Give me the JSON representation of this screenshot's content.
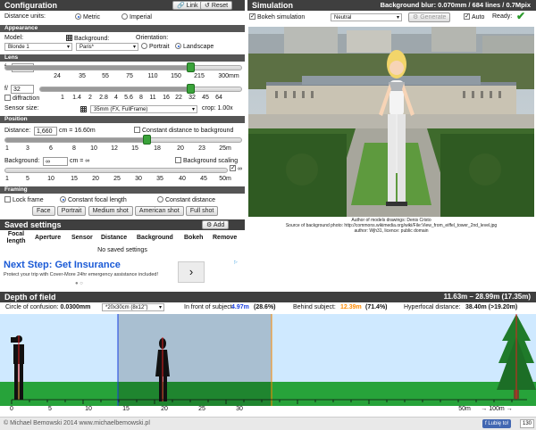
{
  "config": {
    "title": "Configuration",
    "link_label": "Link",
    "reset_label": "Reset",
    "distance_units_label": "Distance units:",
    "metric_label": "Metric",
    "imperial_label": "Imperial",
    "appearance_label": "Appearance",
    "model_label": "Model:",
    "model_value": "Blonde 1",
    "background_label": "Background:",
    "background_value": "Paris*",
    "orientation_label": "Orientation:",
    "portrait_label": "Portrait",
    "landscape_label": "Landscape",
    "lens_label": "Lens",
    "f_label": "f=",
    "f_value": "192",
    "f_unit": "mm",
    "focal_ticks": [
      "24",
      "35",
      "55",
      "75",
      "110",
      "150",
      "215",
      "300mm"
    ],
    "aperture_label": "f/",
    "aperture_value": "32",
    "diffraction_label": "diffraction",
    "aperture_ticks": [
      "1",
      "1.4",
      "2",
      "2.8",
      "4",
      "5.6",
      "8",
      "11",
      "16",
      "22",
      "32",
      "45",
      "64"
    ],
    "sensor_label": "Sensor size:",
    "sensor_value": "35mm (FX, FullFrame)",
    "crop_label": "crop: 1.00x",
    "position_label": "Position",
    "distance_label": "Distance:",
    "distance_value": "1,660",
    "distance_unit": "cm = 16.60m",
    "constant_distance_bg_label": "Constant distance to background",
    "distance_ticks": [
      "1",
      "3",
      "6",
      "8",
      "10",
      "12",
      "15",
      "18",
      "20",
      "23",
      "25m"
    ],
    "background_dist_label": "Background:",
    "background_dist_value": "∞",
    "background_dist_unit": "cm = ∞",
    "background_scaling_label": "Background scaling",
    "infinity_label": "∞",
    "background_ticks": [
      "1",
      "5",
      "10",
      "15",
      "20",
      "25",
      "30",
      "35",
      "40",
      "45",
      "50m"
    ],
    "framing_label": "Framing",
    "lock_frame_label": "Lock frame",
    "constant_focal_label": "Constant focal length",
    "constant_distance_label": "Constant distance",
    "framing_buttons": [
      "Face",
      "Portrait",
      "Medium shot",
      "American shot",
      "Full shot"
    ]
  },
  "saved": {
    "title": "Saved settings",
    "add_label": "Add",
    "columns": [
      "Focal length",
      "Aperture",
      "Sensor",
      "Distance",
      "Background",
      "Bokeh",
      "Remove"
    ],
    "empty_label": "No saved settings"
  },
  "ad": {
    "title": "Next Step: Get Insurance",
    "body": "Protect your trip with Cover-More 24hr emergency assistance included!"
  },
  "simulation": {
    "title": "Simulation",
    "info": "Background blur: 0.070mm / 684 lines / 0.7Mpix",
    "bokeh_label": "Bokeh simulation",
    "bokeh_mode": "Neutral",
    "generate_label": "Generate",
    "auto_label": "Auto",
    "ready_label": "Ready:",
    "credit_line1": "Author of models drawings: Denis Cristo",
    "credit_line2": "Source of background photo: http://commons.wikimedia.org/wiki/File:View_from_eiffel_tower_2nd_level.jpg",
    "credit_line3": "author: Wjh31, licence: public domain"
  },
  "dof": {
    "title": "Depth of field",
    "range": "11.63m – 28.99m (17.35m)",
    "coc_label": "Circle of confusion:",
    "coc_value": "0.0300mm",
    "coc_select": "*20x30cm (8x12\")",
    "front_label": "In front of subject:",
    "front_value": "4.97m",
    "front_pct": "(28.6%)",
    "behind_label": "Behind subject:",
    "behind_value": "12.39m",
    "behind_pct": "(71.4%)",
    "hyper_label": "Hyperfocal distance:",
    "hyper_value": "38.40m (>19.20m)",
    "axis_ticks": [
      "0",
      "5",
      "10",
      "15",
      "20",
      "25",
      "30"
    ],
    "axis_end": "50m",
    "axis_inf": "→ 100m →",
    "colors": {
      "front": "#1a3fe0",
      "behind": "#ff8a00",
      "sky": "#cfe9ff",
      "grass": "#27a33a"
    }
  },
  "footer": {
    "copyright": "© Michael Bemowski 2014 www.michaelbemowski.pl",
    "like_label": "Lubię to!",
    "like_count": "130"
  }
}
